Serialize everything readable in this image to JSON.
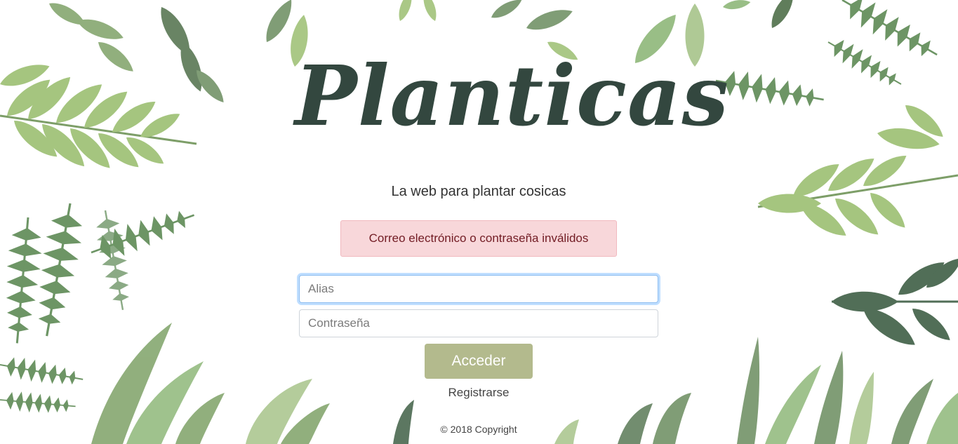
{
  "app": {
    "logo_text": "Planticas",
    "tagline": "La web para plantar cosicas"
  },
  "alert": {
    "message": "Correo electrónico o contraseña inválidos"
  },
  "login_form": {
    "alias_placeholder": "Alias",
    "password_placeholder": "Contraseña",
    "submit_label": "Acceder",
    "register_link": "Registrarse"
  },
  "footer": {
    "copyright": "© 2018 Copyright"
  },
  "colors": {
    "logo": "#33473f",
    "button": "#b3ba8d",
    "alert_bg": "#f8d7da",
    "leaf_dark": "#5a7a57",
    "leaf_light": "#9fbf7a"
  }
}
